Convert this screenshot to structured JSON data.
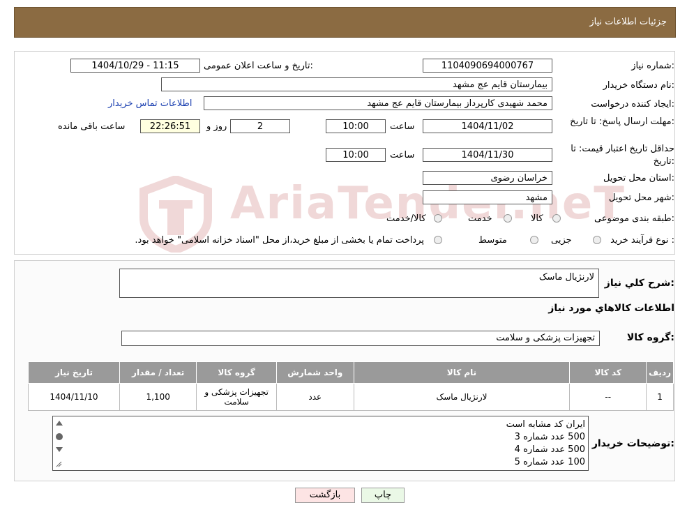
{
  "header": {
    "title": "جزئیات اطلاعات نیاز"
  },
  "watermark": "AriaTender.neT",
  "form": {
    "need_number_label": "شماره نیاز:",
    "need_number": "1104090694000767",
    "announce_label": "تاریخ و ساعت اعلان عمومی:",
    "announce_value": "1404/10/29 - 11:15",
    "buyer_org_label": "نام دستگاه خریدار:",
    "buyer_org": "بیمارستان قایم  عج  مشهد",
    "creator_label": "ایجاد کننده درخواست:",
    "creator": "محمد شهیدی کارپرداز بیمارستان قایم  عج  مشهد",
    "contact_link": "اطلاعات تماس خریدار",
    "deadline_label": "مهلت ارسال پاسخ: تا تاریخ:",
    "deadline_date": "1404/11/02",
    "time_label": "ساعت",
    "deadline_time": "10:00",
    "days_value": "2",
    "days_label": "روز و",
    "remaining_time": "22:26:51",
    "remaining_label": "ساعت باقی مانده",
    "validity_label": "حداقل تاریخ اعتبار قیمت: تا تاریخ:",
    "validity_date": "1404/11/30",
    "validity_time": "10:00",
    "province_label": "استان محل تحویل:",
    "province": "خراسان رضوی",
    "city_label": "شهر محل تحویل:",
    "city": "مشهد",
    "category_label": "طبقه بندی موضوعی:",
    "category_options": [
      "کالا",
      "خدمت",
      "کالا/خدمت"
    ],
    "purchase_type_label": "نوع فرآیند خرید :",
    "purchase_options": [
      "جزیی",
      "متوسط"
    ],
    "purchase_note": "پرداخت تمام یا بخشی از مبلغ خرید،از محل \"اسناد خزانه اسلامی\" خواهد بود."
  },
  "details": {
    "summary_label": "شرح کلي نياز:",
    "summary_value": "لارنژیال ماسک",
    "goods_info_title": "اطلاعات کالاهاي مورد نياز",
    "goods_group_label": "گروه کالا:",
    "goods_group_value": "تجهیزات پزشکی و سلامت",
    "table": {
      "headers": [
        "رديف",
        "کد کالا",
        "نام کالا",
        "واحد شمارش",
        "گروه کالا",
        "تعداد / مقدار",
        "تاريخ نياز"
      ],
      "rows": [
        [
          "1",
          "--",
          "لارنژیال ماسک",
          "عدد",
          "تجهیزات پزشکی و سلامت",
          "1,100",
          "1404/11/10"
        ]
      ]
    },
    "buyer_notes_label": "توضیحات خریدار:",
    "buyer_notes": [
      "ایران  کد مشابه است",
      "500 عدد شماره 3",
      "500 عدد شماره 4",
      "100 عدد شماره 5"
    ]
  },
  "buttons": {
    "print": "چاپ",
    "back": "بازگشت"
  }
}
